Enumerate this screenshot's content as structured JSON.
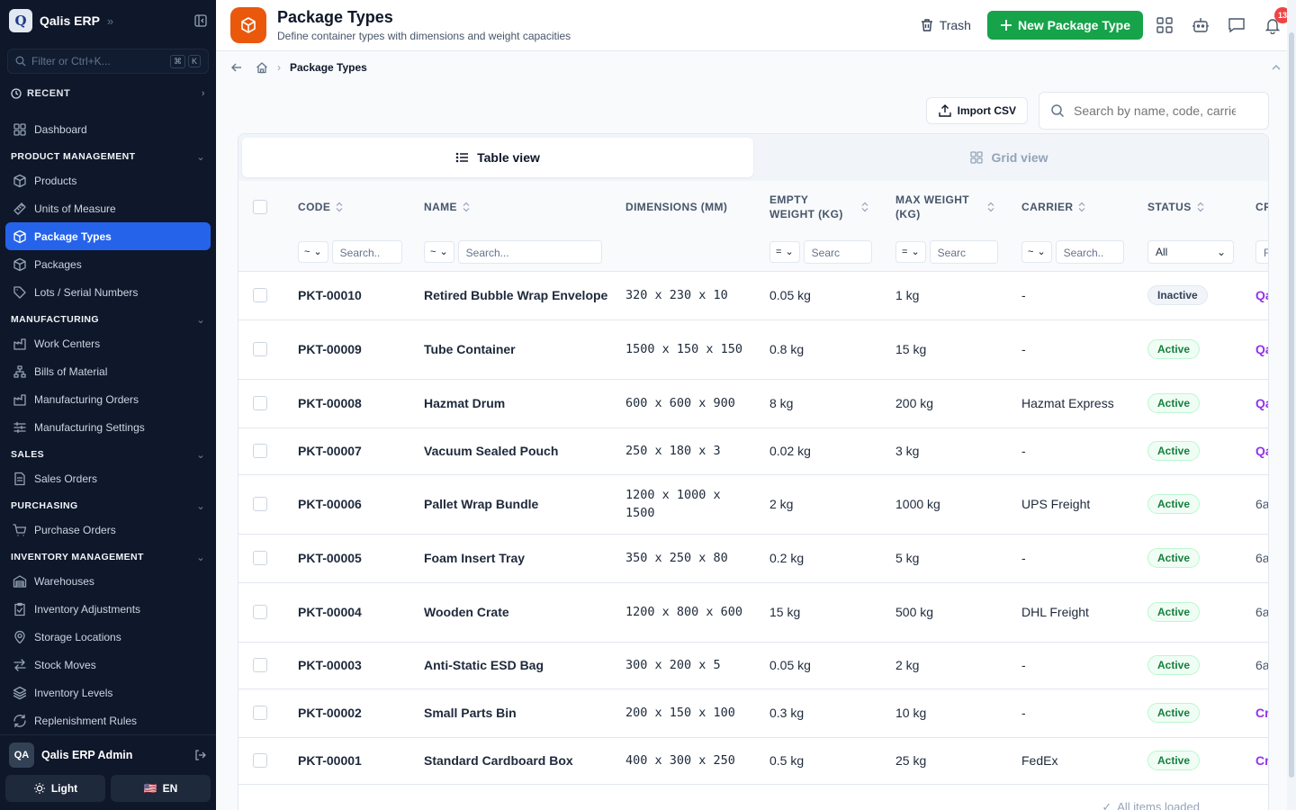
{
  "app": {
    "logo_letter": "Q",
    "name": "Qalis ERP"
  },
  "sidebar": {
    "filter_placeholder": "Filter or Ctrl+K...",
    "kbd": [
      "⌘",
      "K"
    ],
    "recent_label": "RECENT",
    "dashboard": "Dashboard",
    "sections": [
      {
        "title": "PRODUCT MANAGEMENT",
        "items": [
          "Products",
          "Units of Measure",
          "Package Types",
          "Packages",
          "Lots / Serial Numbers"
        ]
      },
      {
        "title": "MANUFACTURING",
        "items": [
          "Work Centers",
          "Bills of Material",
          "Manufacturing Orders",
          "Manufacturing Settings"
        ]
      },
      {
        "title": "SALES",
        "items": [
          "Sales Orders"
        ]
      },
      {
        "title": "PURCHASING",
        "items": [
          "Purchase Orders"
        ]
      },
      {
        "title": "INVENTORY MANAGEMENT",
        "items": [
          "Warehouses",
          "Inventory Adjustments",
          "Storage Locations",
          "Stock Moves",
          "Inventory Levels",
          "Replenishment Rules"
        ]
      }
    ],
    "active_item": "Package Types",
    "user": {
      "initials": "QA",
      "name": "Qalis ERP Admin"
    },
    "theme_label": "Light",
    "lang_flag": "🇺🇸",
    "lang_label": "EN"
  },
  "header": {
    "title": "Package Types",
    "subtitle": "Define container types with dimensions and weight capacities",
    "trash_label": "Trash",
    "new_label": "New Package Type",
    "notif_count": "13",
    "accent": "#ea580c",
    "primary": "#16a34a"
  },
  "breadcrumb": {
    "current": "Package Types"
  },
  "toolbar": {
    "import_label": "Import CSV",
    "search_placeholder": "Search by name, code, carrier..."
  },
  "views": {
    "table": "Table view",
    "grid": "Grid view"
  },
  "table": {
    "columns": [
      "CODE",
      "NAME",
      "DIMENSIONS (MM)",
      "EMPTY WEIGHT (KG)",
      "MAX WEIGHT (KG)",
      "CARRIER",
      "STATUS",
      "CR"
    ],
    "filters": {
      "op_tilde": "~",
      "op_eq": "=",
      "search": "Search..",
      "search2": "Search...",
      "search_short": "Searc",
      "status_all": "All",
      "cr": "Fi"
    },
    "rows": [
      {
        "code": "PKT-00010",
        "name": "Retired Bubble Wrap Envelope",
        "dims": "320 x 230 x 10",
        "empty": "0.05 kg",
        "max": "1 kg",
        "carrier": "-",
        "status": "Inactive",
        "cr": "Qa"
      },
      {
        "code": "PKT-00009",
        "name": "Tube Container",
        "dims": "1500 x 150 x 150",
        "empty": "0.8 kg",
        "max": "15 kg",
        "carrier": "-",
        "status": "Active",
        "cr": "Qa"
      },
      {
        "code": "PKT-00008",
        "name": "Hazmat Drum",
        "dims": "600 x 600 x 900",
        "empty": "8 kg",
        "max": "200 kg",
        "carrier": "Hazmat Express",
        "status": "Active",
        "cr": "Qa"
      },
      {
        "code": "PKT-00007",
        "name": "Vacuum Sealed Pouch",
        "dims": "250 x 180 x 3",
        "empty": "0.02 kg",
        "max": "3 kg",
        "carrier": "-",
        "status": "Active",
        "cr": "Qa"
      },
      {
        "code": "PKT-00006",
        "name": "Pallet Wrap Bundle",
        "dims": "1200 x 1000 x 1500",
        "empty": "2 kg",
        "max": "1000 kg",
        "carrier": "UPS Freight",
        "status": "Active",
        "cr": "6a"
      },
      {
        "code": "PKT-00005",
        "name": "Foam Insert Tray",
        "dims": "350 x 250 x 80",
        "empty": "0.2 kg",
        "max": "5 kg",
        "carrier": "-",
        "status": "Active",
        "cr": "6a"
      },
      {
        "code": "PKT-00004",
        "name": "Wooden Crate",
        "dims": "1200 x 800 x 600",
        "empty": "15 kg",
        "max": "500 kg",
        "carrier": "DHL Freight",
        "status": "Active",
        "cr": "6a"
      },
      {
        "code": "PKT-00003",
        "name": "Anti-Static ESD Bag",
        "dims": "300 x 200 x 5",
        "empty": "0.05 kg",
        "max": "2 kg",
        "carrier": "-",
        "status": "Active",
        "cr": "6a"
      },
      {
        "code": "PKT-00002",
        "name": "Small Parts Bin",
        "dims": "200 x 150 x 100",
        "empty": "0.3 kg",
        "max": "10 kg",
        "carrier": "-",
        "status": "Active",
        "cr": "Cr"
      },
      {
        "code": "PKT-00001",
        "name": "Standard Cardboard Box",
        "dims": "400 x 300 x 250",
        "empty": "0.5 kg",
        "max": "25 kg",
        "carrier": "FedEx",
        "status": "Active",
        "cr": "Cr"
      }
    ],
    "footer": "All items loaded"
  }
}
